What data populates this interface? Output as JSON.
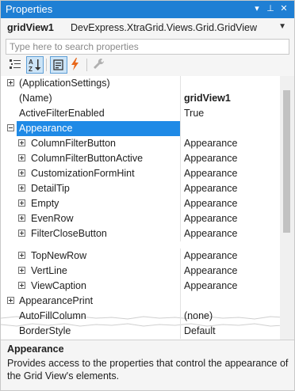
{
  "window": {
    "title": "Properties",
    "dropdown_glyph": "▾",
    "pin_glyph": "⊥",
    "close_glyph": "✕"
  },
  "object_selector": {
    "name": "gridView1",
    "type": "DevExpress.XtraGrid.Views.Grid.GridView",
    "arrow": "▼"
  },
  "search": {
    "placeholder": "Type here to search properties"
  },
  "toolbar": {
    "buttons": [
      {
        "id": "categorized",
        "icon": "categorized-icon",
        "active": false
      },
      {
        "id": "alphabetical",
        "icon": "alphabetical-sort-icon",
        "active": true
      },
      {
        "id": "properties",
        "icon": "properties-icon",
        "active": true
      },
      {
        "id": "events",
        "icon": "events-lightning-icon",
        "active": false
      },
      {
        "id": "property-pages",
        "icon": "wrench-icon",
        "active": false
      }
    ]
  },
  "grid": {
    "upper_rows": [
      {
        "label": "(ApplicationSettings)",
        "value": "",
        "expander": "plus",
        "indent": 0
      },
      {
        "label": "(Name)",
        "value": "gridView1",
        "value_bold": true,
        "expander": "",
        "indent": 0
      },
      {
        "label": "ActiveFilterEnabled",
        "value": "True",
        "expander": "",
        "indent": 0
      },
      {
        "label": "Appearance",
        "value": "",
        "expander": "minus",
        "indent": 0,
        "selected": true
      },
      {
        "label": "ColumnFilterButton",
        "value": "Appearance",
        "expander": "plus",
        "indent": 1
      },
      {
        "label": "ColumnFilterButtonActive",
        "value": "Appearance",
        "expander": "plus",
        "indent": 1
      },
      {
        "label": "CustomizationFormHint",
        "value": "Appearance",
        "expander": "plus",
        "indent": 1
      },
      {
        "label": "DetailTip",
        "value": "Appearance",
        "expander": "plus",
        "indent": 1
      },
      {
        "label": "Empty",
        "value": "Appearance",
        "expander": "plus",
        "indent": 1
      },
      {
        "label": "EvenRow",
        "value": "Appearance",
        "expander": "plus",
        "indent": 1
      },
      {
        "label": "FilterCloseButton",
        "value": "Appearance",
        "expander": "plus",
        "indent": 1
      }
    ],
    "lower_rows": [
      {
        "label": "TopNewRow",
        "value": "Appearance",
        "expander": "plus",
        "indent": 1
      },
      {
        "label": "VertLine",
        "value": "Appearance",
        "expander": "plus",
        "indent": 1
      },
      {
        "label": "ViewCaption",
        "value": "Appearance",
        "expander": "plus",
        "indent": 1
      },
      {
        "label": "AppearancePrint",
        "value": "",
        "expander": "plus",
        "indent": 0
      },
      {
        "label": "AutoFillColumn",
        "value": "(none)",
        "expander": "",
        "indent": 0
      },
      {
        "label": "BorderStyle",
        "value": "Default",
        "expander": "",
        "indent": 0
      }
    ]
  },
  "description": {
    "title": "Appearance",
    "text": "Provides access to the properties that control the appearance of the Grid View's elements."
  },
  "colors": {
    "title_bar": "#1f7fd4",
    "selection": "#1f8ae6",
    "lightning": "#e8681b"
  }
}
